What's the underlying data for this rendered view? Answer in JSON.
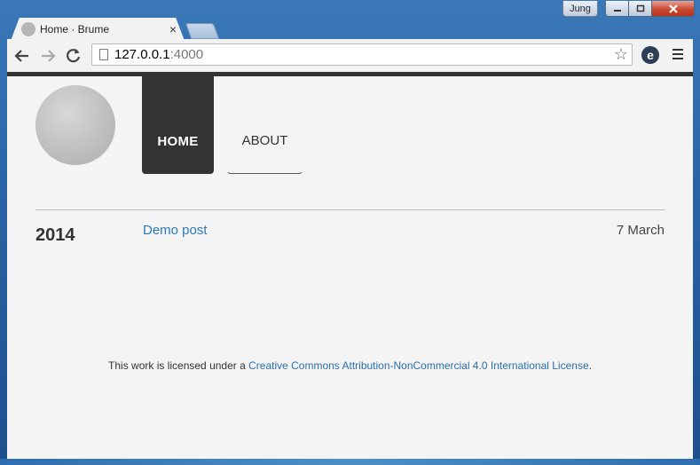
{
  "window": {
    "user_badge": "Jung"
  },
  "tab": {
    "title": "Home · Brume",
    "close": "×"
  },
  "omnibox": {
    "host": "127.0.0.1",
    "port": ":4000"
  },
  "icons": {
    "back": "back-arrow-icon",
    "forward": "forward-arrow-icon",
    "reload": "reload-icon",
    "star": "star-icon",
    "extension": "extension-icon",
    "menu": "hamburger-menu-icon"
  },
  "nav": {
    "home": "HOME",
    "about": "ABOUT"
  },
  "posts": {
    "year": "2014",
    "items": [
      {
        "title": "Demo post",
        "date": "7 March"
      }
    ]
  },
  "footer": {
    "text": "This work is licensed under a ",
    "link": "Creative Commons Attribution-NonCommercial 4.0 International License",
    "suffix": "."
  },
  "colors": {
    "accent": "#2a7ab8",
    "nav_active_bg": "#333333",
    "page_bg": "#f4f4f4"
  }
}
